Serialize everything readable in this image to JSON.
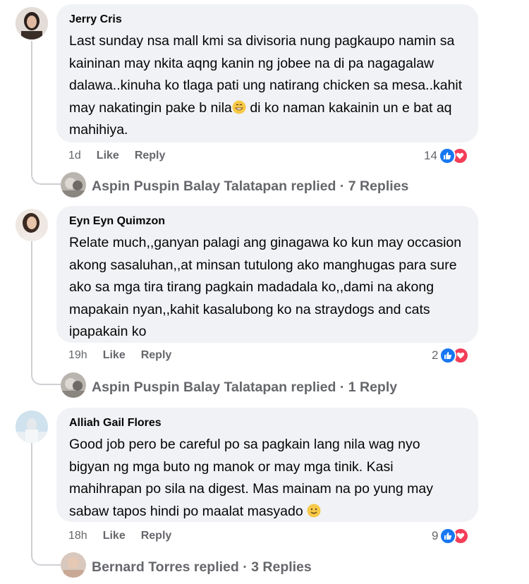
{
  "comments": [
    {
      "author": "Jerry Cris",
      "text": "Last sunday nsa mall kmi sa divisoria nung pagkaupo namin sa kaininan may nkita aqng kanin ng jobee na di pa nagagalaw dalawa..kinuha ko tlaga pati ung natirang chicken sa mesa..kahit may nakatingin pake b nila",
      "text_after_emoji": " di ko naman kakainin un e bat aq mahihiya.",
      "emoji": "grinning-face-icon",
      "time": "1d",
      "like": "Like",
      "reply": "Reply",
      "reaction_count": "14",
      "replies_author": "Aspin Puspin Balay Talatapan",
      "replies_text": "replied · 7 Replies"
    },
    {
      "author": "Eyn Eyn Quimzon",
      "text": "Relate much,,ganyan palagi ang ginagawa ko kun may occasion akong sasaluhan,,at minsan tutulong ako manghugas para sure ako sa mga tira tirang pagkain madadala ko,,dami na akong mapakain nyan,,kahit kasalubong ko na straydogs and cats ipapakain ko",
      "time": "19h",
      "like": "Like",
      "reply": "Reply",
      "reaction_count": "2",
      "replies_author": "Aspin Puspin Balay Talatapan",
      "replies_text": "replied · 1 Reply"
    },
    {
      "author": "Alliah Gail Flores",
      "text": "Good job pero be careful po sa pagkain lang nila wag nyo bigyan ng mga buto ng manok or may mga tinik. Kasi mahihrapan po sila na digest. Mas mainam na po yung may sabaw tapos hindi po maalat masyado",
      "emoji": "smiling-face-icon",
      "time": "18h",
      "like": "Like",
      "reply": "Reply",
      "reaction_count": "9",
      "replies_author": "Bernard Torres",
      "replies_text": "replied · 3 Replies"
    }
  ],
  "colors": {
    "bubble": "#f0f2f5",
    "meta": "#65676b",
    "like": "#1877f2",
    "love": "#f33e58"
  }
}
